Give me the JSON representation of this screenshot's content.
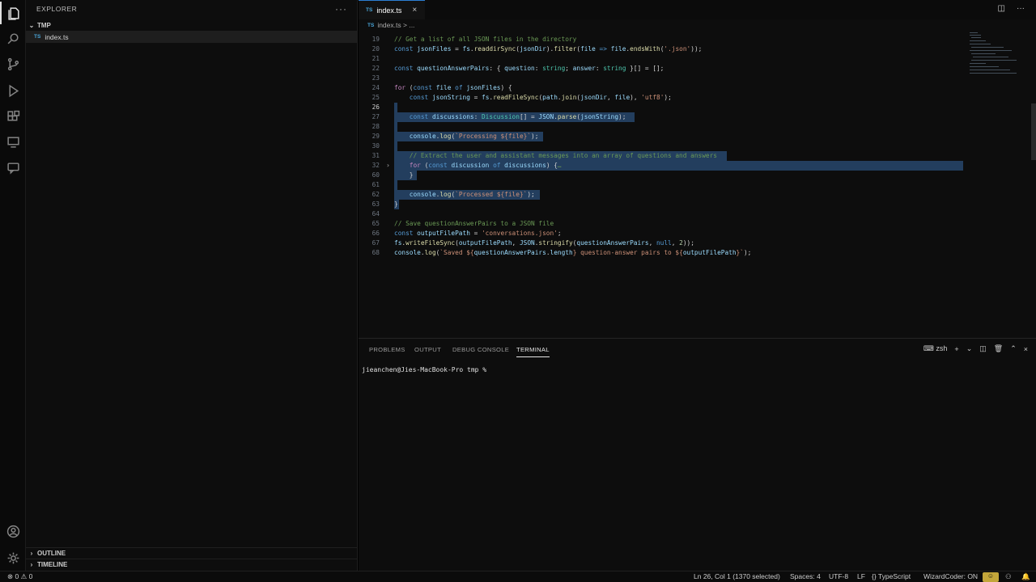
{
  "sidebar": {
    "title": "EXPLORER",
    "more": "···",
    "folder": "TMP",
    "file_badge": "TS",
    "file": "index.ts",
    "outline": "OUTLINE",
    "timeline": "TIMELINE"
  },
  "tabs": {
    "badge": "TS",
    "active": "index.ts",
    "close": "×"
  },
  "breadcrumb": {
    "badge": "TS",
    "file": "index.ts",
    "sep": ">",
    "rest": "..."
  },
  "code": {
    "l19": {
      "n": "19",
      "t": "// Get a list of all JSON files in the directory"
    },
    "l20": {
      "n": "20",
      "a": "const ",
      "b": "jsonFiles",
      "c": " = ",
      "d": "fs",
      "e": ".",
      "f": "readdirSync",
      "g": "(",
      "h": "jsonDir",
      "i": ").",
      "j": "filter",
      "k": "(",
      "l": "file",
      "m": " => ",
      "o": "file",
      "p": ".",
      "q": "endsWith",
      "r": "(",
      "s": "'.json'",
      "u": "));"
    },
    "l21": {
      "n": "21"
    },
    "l22": {
      "n": "22",
      "a": "const ",
      "b": "questionAnswerPairs",
      "c": ": { ",
      "d": "question",
      "e": ": ",
      "f": "string",
      "g": "; ",
      "h": "answer",
      "i": ": ",
      "j": "string",
      "k": " }[] = [];"
    },
    "l23": {
      "n": "23"
    },
    "l24": {
      "n": "24",
      "a": "for",
      "b": " (",
      "c": "const ",
      "d": "file",
      "e": " of ",
      "f": "jsonFiles",
      "g": ") {"
    },
    "l25": {
      "n": "25",
      "a": "    const ",
      "b": "jsonString",
      "c": " = ",
      "d": "fs",
      "e": ".",
      "f": "readFileSync",
      "g": "(",
      "h": "path",
      "i": ".",
      "j": "join",
      "k": "(",
      "l": "jsonDir",
      "m": ", ",
      "o": "file",
      "p": "), ",
      "q": "'utf8'",
      "r": ");"
    },
    "l26": {
      "n": "26"
    },
    "l27": {
      "n": "27",
      "a": "    const ",
      "b": "discussions",
      "c": ": ",
      "d": "Discussion",
      "e": "[] = ",
      "f": "JSON",
      "g": ".",
      "h": "parse",
      "i": "(",
      "j": "jsonString",
      "k": ");"
    },
    "l28": {
      "n": "28"
    },
    "l29": {
      "n": "29",
      "a": "    ",
      "b": "console",
      "c": ".",
      "d": "log",
      "e": "(",
      "f": "`Processing ${file}`",
      "g": ");"
    },
    "l30": {
      "n": "30"
    },
    "l31": {
      "n": "31",
      "t": "    // Extract the user and assistant messages into an array of questions and answers"
    },
    "l32": {
      "n": "32",
      "a": "    ",
      "b": "for",
      "c": " (",
      "d": "const ",
      "e": "discussion",
      "f": " of ",
      "g": "discussions",
      "h": ") {",
      "i": "…"
    },
    "l60": {
      "n": "60",
      "t": "    }"
    },
    "l61": {
      "n": "61"
    },
    "l62": {
      "n": "62",
      "a": "    ",
      "b": "console",
      "c": ".",
      "d": "log",
      "e": "(",
      "f": "`Processed ${file}`",
      "g": ");"
    },
    "l63": {
      "n": "63",
      "t": "}"
    },
    "l64": {
      "n": "64"
    },
    "l65": {
      "n": "65",
      "t": "// Save questionAnswerPairs to a JSON file"
    },
    "l66": {
      "n": "66",
      "a": "const ",
      "b": "outputFilePath",
      "c": " = ",
      "d": "'conversations.json'",
      "e": ";"
    },
    "l67": {
      "n": "67",
      "a": "fs",
      "b": ".",
      "c": "writeFileSync",
      "d": "(",
      "e": "outputFilePath",
      "f": ", ",
      "g": "JSON",
      "h": ".",
      "i": "stringify",
      "j": "(",
      "k": "questionAnswerPairs",
      "l": ", ",
      "m": "null",
      "o": ", ",
      "p": "2",
      "q": "));"
    },
    "l68": {
      "n": "68",
      "a": "console",
      "b": ".",
      "c": "log",
      "d": "(",
      "e": "`Saved ${",
      "f": "questionAnswerPairs",
      "g": ".",
      "h": "length",
      "i": "} question-answer pairs to ${",
      "j": "outputFilePath",
      "k": "}`",
      "l": ");"
    }
  },
  "panel": {
    "tabs": [
      "PROBLEMS",
      "OUTPUT",
      "DEBUG CONSOLE",
      "TERMINAL"
    ],
    "shell": "zsh",
    "prompt": "jieanchen@Jies-MacBook-Pro tmp %"
  },
  "status": {
    "errors": "0",
    "warnings": "0",
    "position": "Ln 26, Col 1 (1370 selected)",
    "spaces": "Spaces: 4",
    "encoding": "UTF-8",
    "eol": "LF",
    "language": "TypeScript",
    "wizard": "WizardCoder: ON"
  },
  "colors": {
    "accent": "#2b7fd4",
    "selection": "#233e5e",
    "copilot": "#c3a63a"
  }
}
